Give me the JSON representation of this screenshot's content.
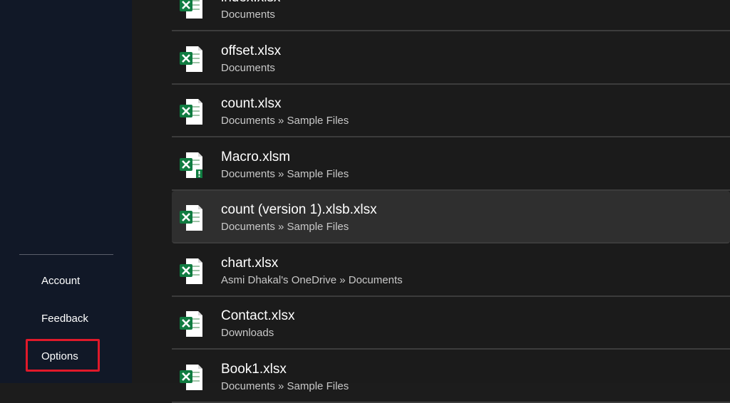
{
  "sidebar": {
    "account_label": "Account",
    "feedback_label": "Feedback",
    "options_label": "Options",
    "highlight_color": "#e0192a"
  },
  "files": [
    {
      "name": "index.xlsx",
      "path": "Documents",
      "icon": "excel-file-icon"
    },
    {
      "name": "offset.xlsx",
      "path": "Documents",
      "icon": "excel-file-icon"
    },
    {
      "name": "count.xlsx",
      "path": "Documents » Sample Files",
      "icon": "excel-file-icon"
    },
    {
      "name": "Macro.xlsm",
      "path": "Documents » Sample Files",
      "icon": "excel-macro-file-icon"
    },
    {
      "name": "count (version 1).xlsb.xlsx",
      "path": "Documents » Sample Files",
      "icon": "excel-file-icon"
    },
    {
      "name": "chart.xlsx",
      "path": "Asmi Dhakal's OneDrive » Documents",
      "icon": "excel-file-icon"
    },
    {
      "name": "Contact.xlsx",
      "path": "Downloads",
      "icon": "excel-file-icon"
    },
    {
      "name": "Book1.xlsx",
      "path": "Documents » Sample Files",
      "icon": "excel-file-icon"
    }
  ],
  "colors": {
    "excel_green": "#107c41",
    "sidebar_bg": "#111827",
    "main_bg": "#1b1b1b",
    "selected_row_bg": "#2f2f2f"
  }
}
